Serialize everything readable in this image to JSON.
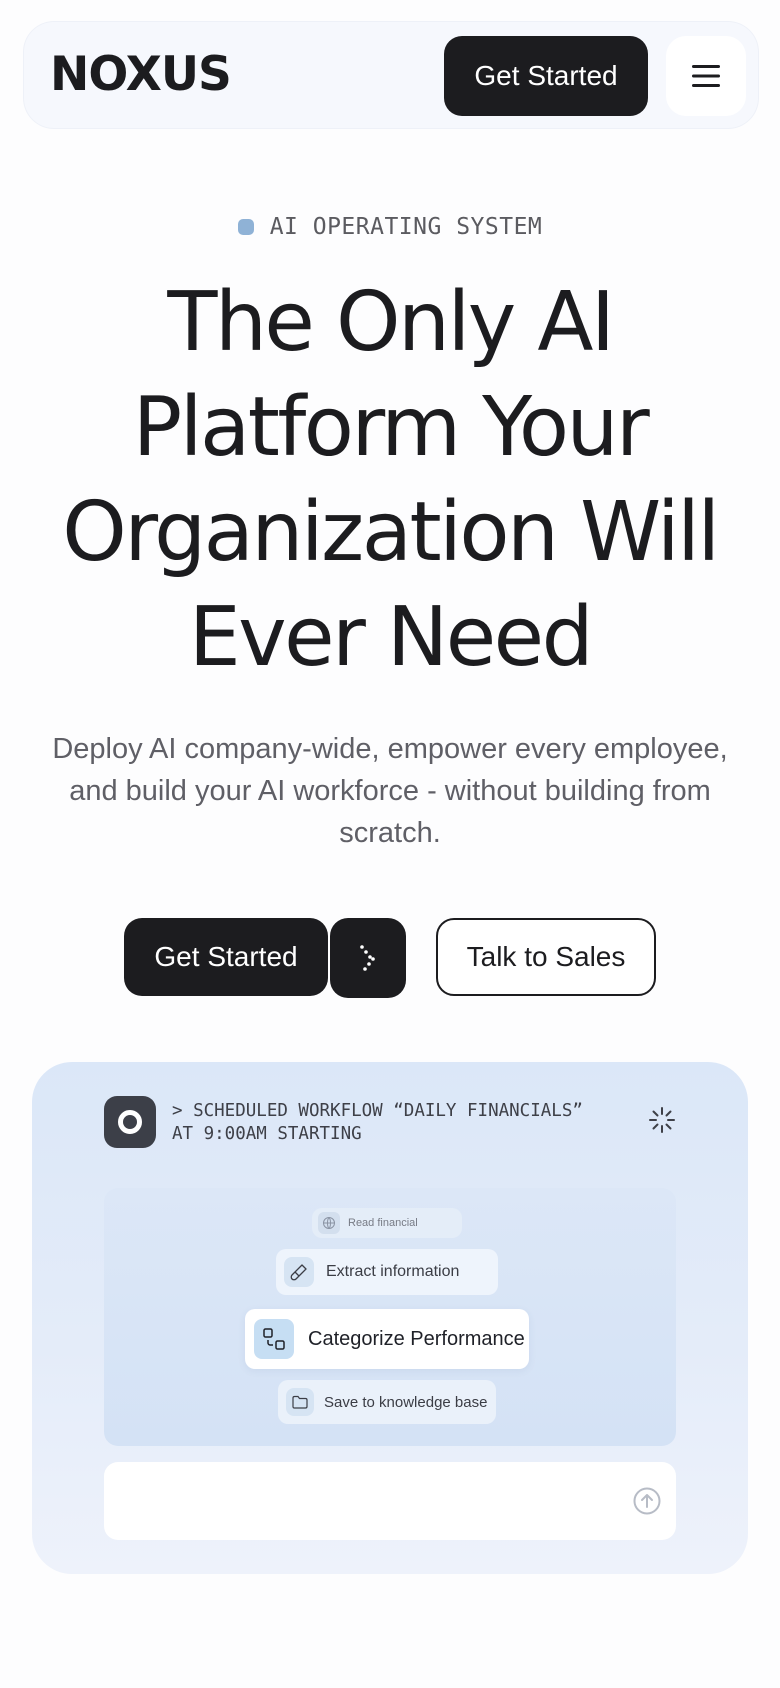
{
  "nav": {
    "logo": "NOXUS",
    "cta_label": "Get Started",
    "menu_icon": "hamburger-menu-icon"
  },
  "hero": {
    "eyebrow": "AI OPERATING SYSTEM",
    "title": "The Only AI Platform Your Organization Will Ever Need",
    "subtitle": "Deploy AI company-wide, empower every employee, and build your AI workforce - without building from scratch.",
    "primary_cta": "Get Started",
    "secondary_cta": "Talk to Sales"
  },
  "demo": {
    "workflow_line1": "> SCHEDULED WORKFLOW “DAILY FINANCIALS”",
    "workflow_line2": "AT 9:00AM STARTING",
    "steps": [
      {
        "label": "Read financial",
        "icon": "globe-icon"
      },
      {
        "label": "Extract information",
        "icon": "brush-icon"
      },
      {
        "label": "Categorize Performance",
        "icon": "shapes-transform-icon"
      },
      {
        "label": "Save to knowledge base",
        "icon": "folder-icon"
      }
    ],
    "prompt_placeholder": ""
  },
  "colors": {
    "primary": "#1c1c1f",
    "accent_dot": "#8fb2d6",
    "panel_bg": "#dbe7f8"
  }
}
